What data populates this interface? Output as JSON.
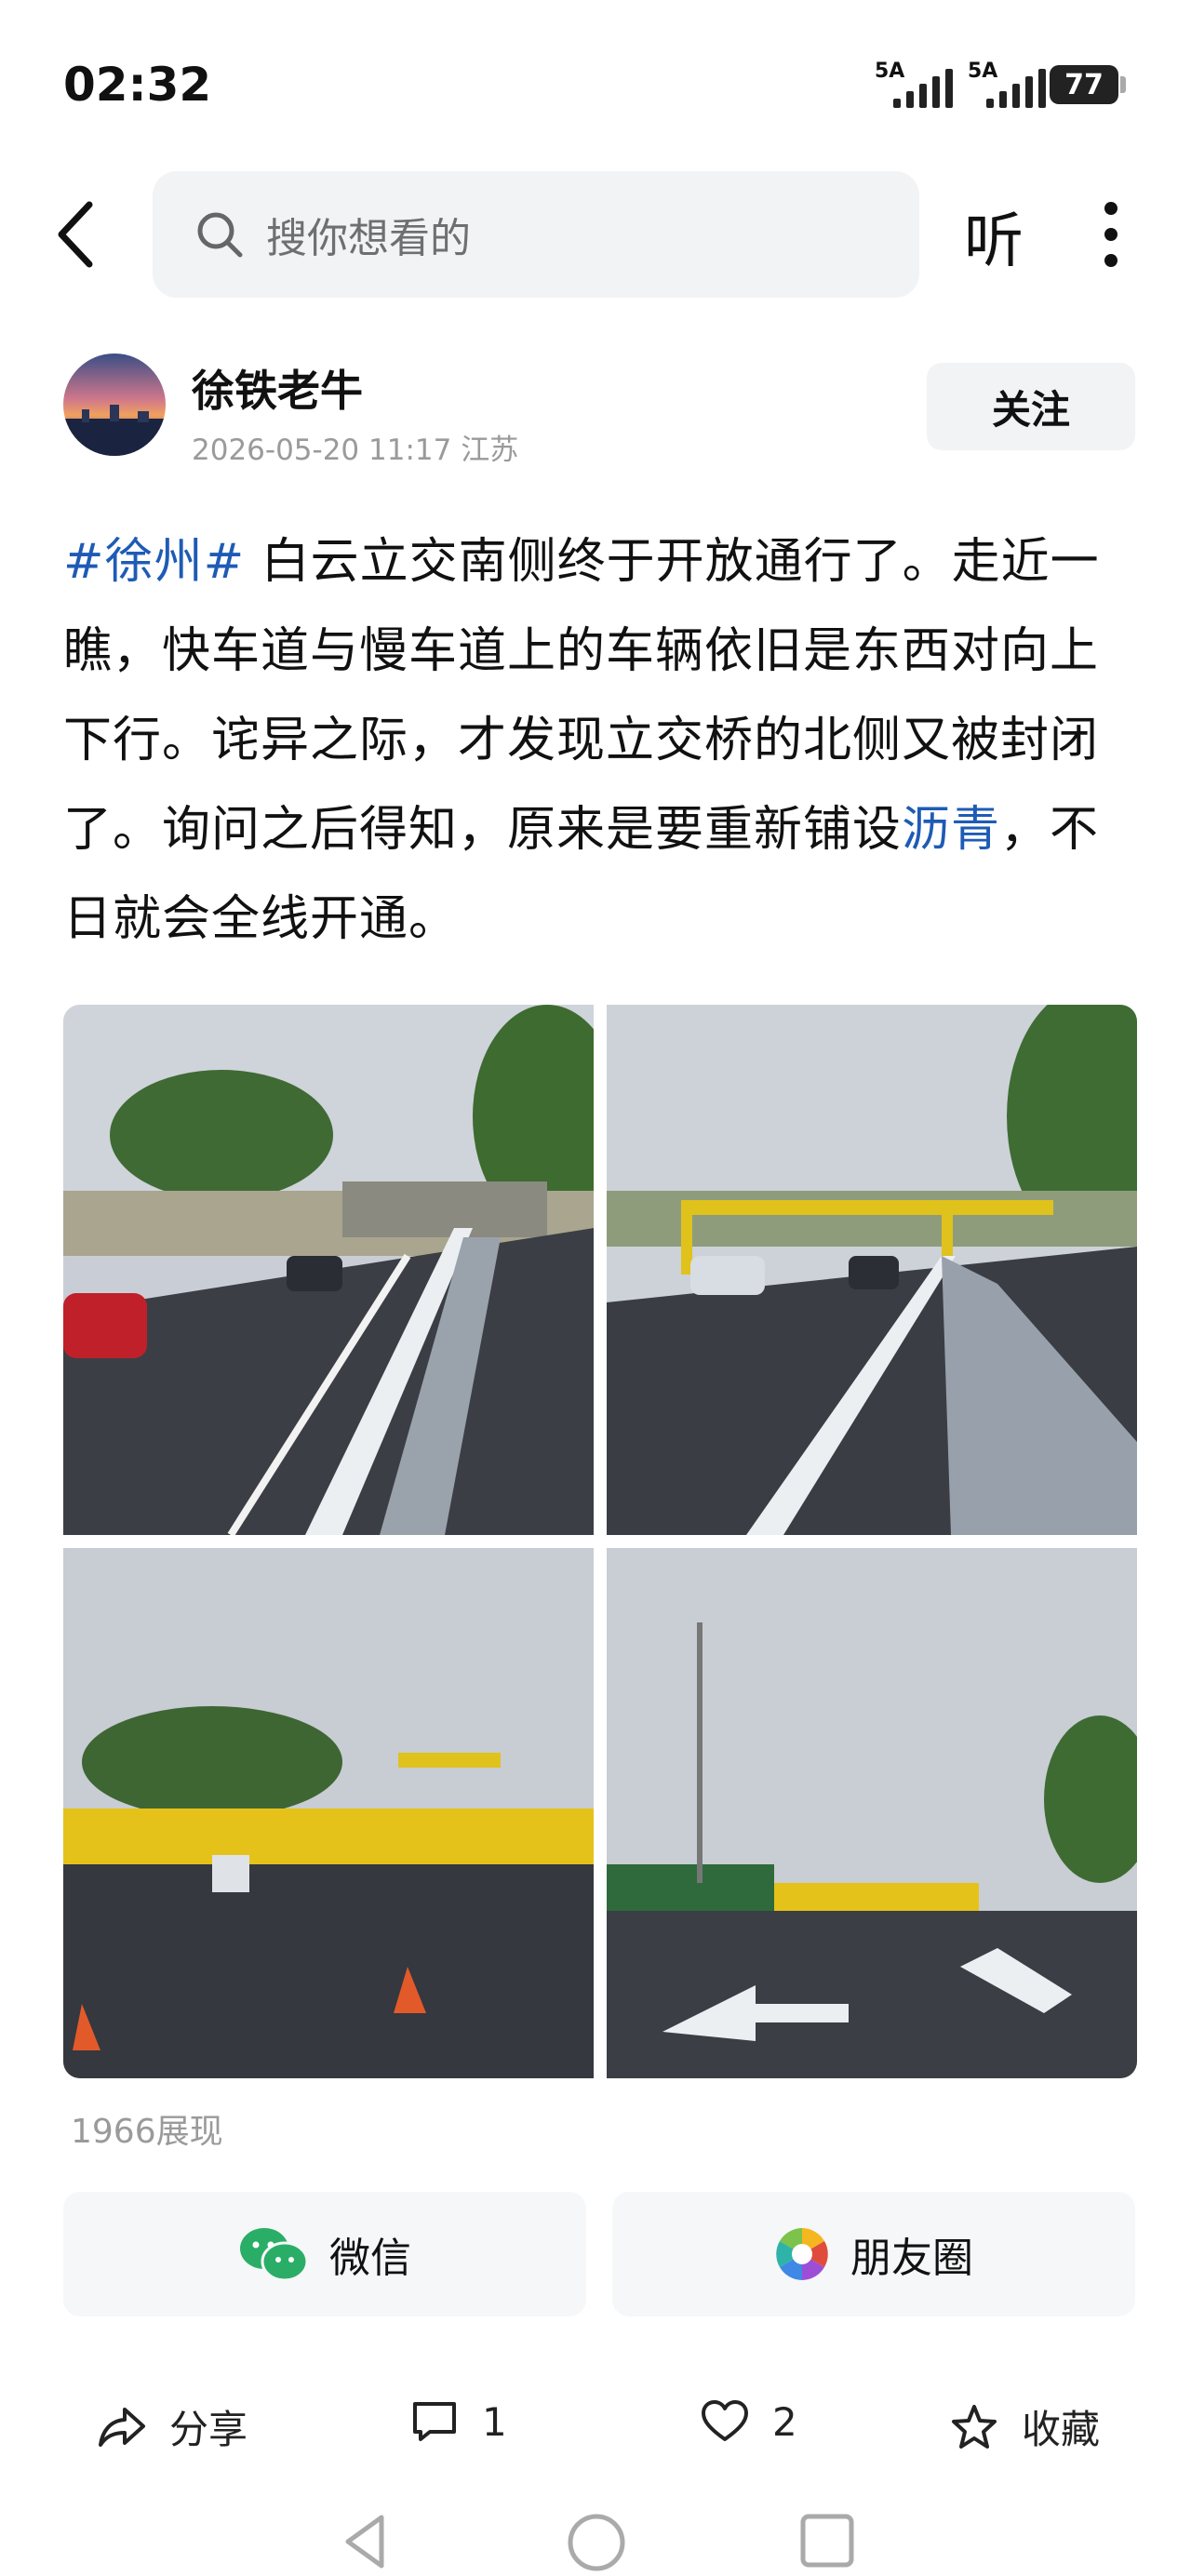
{
  "status": {
    "time": "02:32",
    "signal1": "5A",
    "signal2": "5A",
    "battery": "77"
  },
  "header": {
    "search_placeholder": "搜你想看的",
    "listen_label": "听"
  },
  "author": {
    "name": "徐铁老牛",
    "meta": "2026-05-20 11:17 江苏",
    "follow_label": "关注"
  },
  "post": {
    "hashtag": "#徐州#",
    "text_1": " 白云立交南侧终于开放通行了。走近一瞧，快车道与慢车道上的车辆依旧是东西对向上下行。诧异之际，才发现立交桥的北侧又被封闭了。询问之后得知，原来是要重新铺设",
    "link": "沥青",
    "text_2": "，不日就会全线开通。"
  },
  "views": "1966展现",
  "share": {
    "wechat_label": "微信",
    "moments_label": "朋友圈"
  },
  "actions": {
    "share_label": "分享",
    "comment_count": "1",
    "like_count": "2",
    "collect_label": "收藏"
  },
  "colors": {
    "link": "#1e5bb5",
    "meta": "#9a9a9a",
    "button_bg": "#f2f3f5"
  }
}
